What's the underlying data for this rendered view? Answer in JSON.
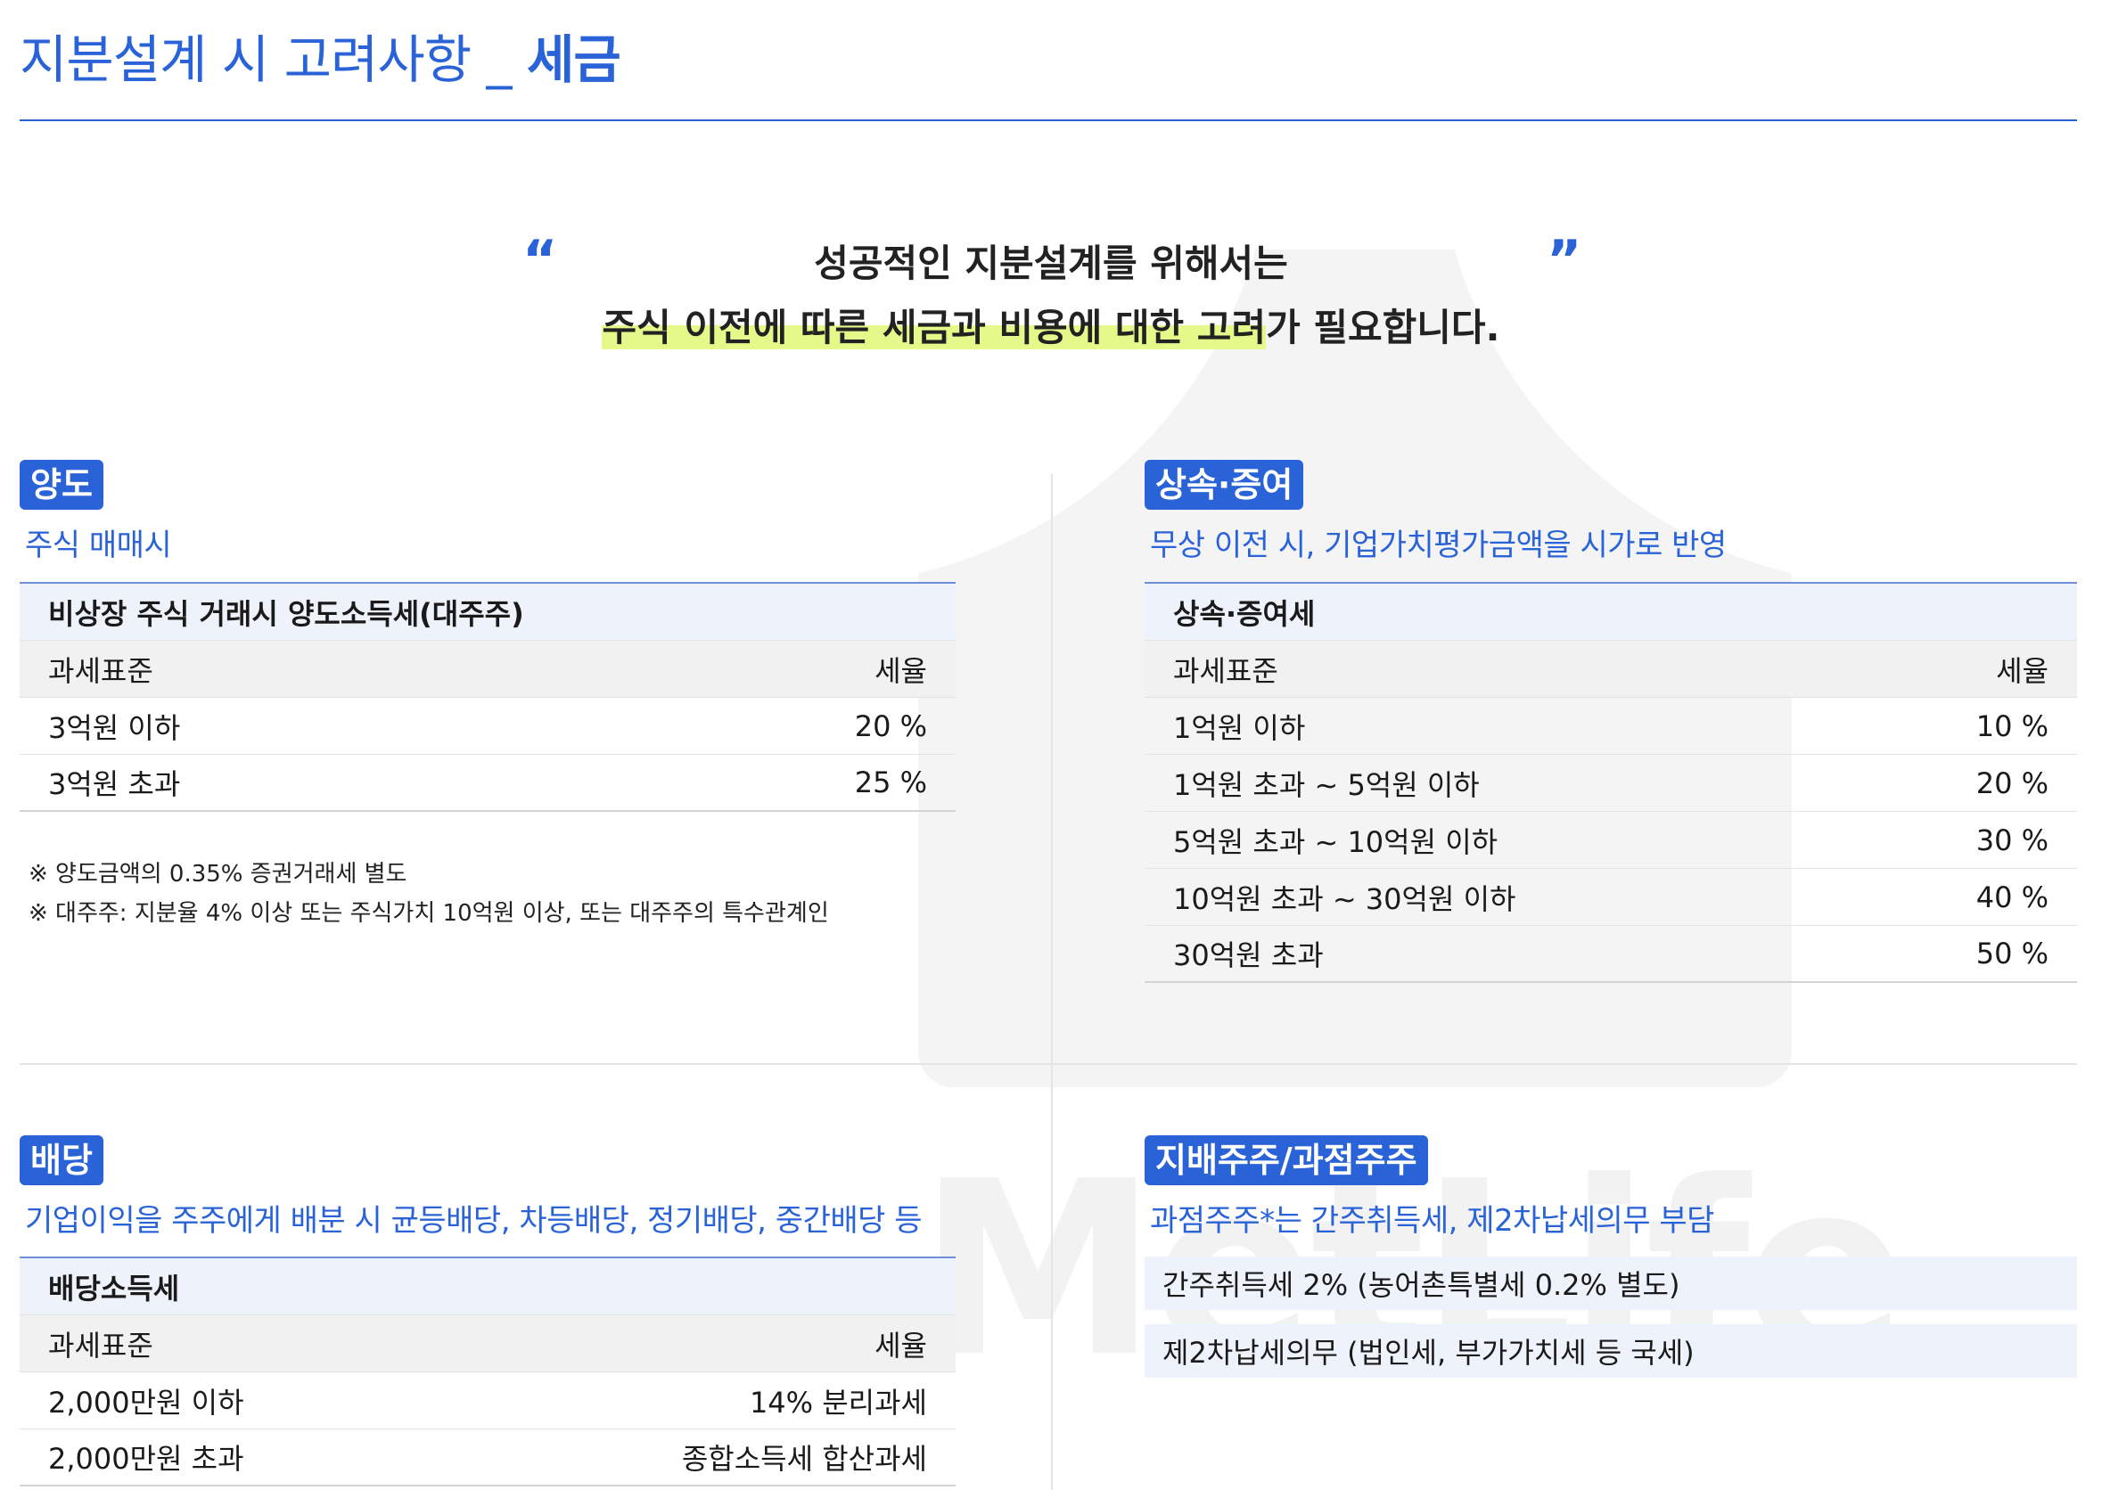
{
  "title": {
    "prefix": "지분설계 시 고려사항 _ ",
    "emphasis": "세금"
  },
  "quote": {
    "open_mark": "“",
    "close_mark": "”",
    "line1": "성공적인 지분설계를 위해서는",
    "line2_highlight": "주식 이전에 따른 세금과 비용에 대한 고려",
    "line2_rest": "가 필요합니다."
  },
  "watermark": "MetLife",
  "sections": {
    "transfer": {
      "badge": "양도",
      "subtitle": "주식 매매시",
      "caption": "비상장 주식 거래시 양도소득세(대주주)",
      "header": {
        "base": "과세표준",
        "rate": "세율"
      },
      "rows": [
        {
          "base": "3억원 이하",
          "rate": "20 %"
        },
        {
          "base": "3억원 초과",
          "rate": "25 %"
        }
      ],
      "notes": [
        "※ 양도금액의 0.35% 증권거래세 별도",
        "※ 대주주: 지분율 4% 이상 또는 주식가치 10억원 이상, 또는 대주주의 특수관계인"
      ]
    },
    "inheritance": {
      "badge": "상속·증여",
      "subtitle": "무상 이전 시, 기업가치평가금액을 시가로 반영",
      "caption": "상속·증여세",
      "header": {
        "base": "과세표준",
        "rate": "세율"
      },
      "rows": [
        {
          "base": "1억원 이하",
          "rate": "10 %"
        },
        {
          "base": "1억원 초과 ~ 5억원 이하",
          "rate": "20 %"
        },
        {
          "base": "5억원 초과 ~ 10억원 이하",
          "rate": "30 %"
        },
        {
          "base": "10억원 초과 ~ 30억원 이하",
          "rate": "40 %"
        },
        {
          "base": "30억원 초과",
          "rate": "50 %"
        }
      ]
    },
    "dividend": {
      "badge": "배당",
      "subtitle": "기업이익을 주주에게 배분 시  균등배당, 차등배당, 정기배당, 중간배당 등",
      "caption": "배당소득세",
      "header": {
        "base": "과세표준",
        "rate": "세율"
      },
      "rows": [
        {
          "base": "2,000만원 이하",
          "rate": "14% 분리과세"
        },
        {
          "base": "2,000만원 초과",
          "rate": "종합소득세 합산과세"
        }
      ]
    },
    "controlling": {
      "badge": "지배주주/과점주주",
      "subtitle": "과점주주*는 간주취득세, 제2차납세의무 부담",
      "items": [
        "간주취득세 2% (농어촌특별세 0.2% 별도)",
        "제2차납세의무 (법인세, 부가가치세 등 국세)"
      ]
    }
  },
  "colors": {
    "accent": "#2a63d8",
    "highlight": "#e4f98a",
    "caption_bg": "#eef2fb",
    "header_bg": "#f1f1f1"
  }
}
